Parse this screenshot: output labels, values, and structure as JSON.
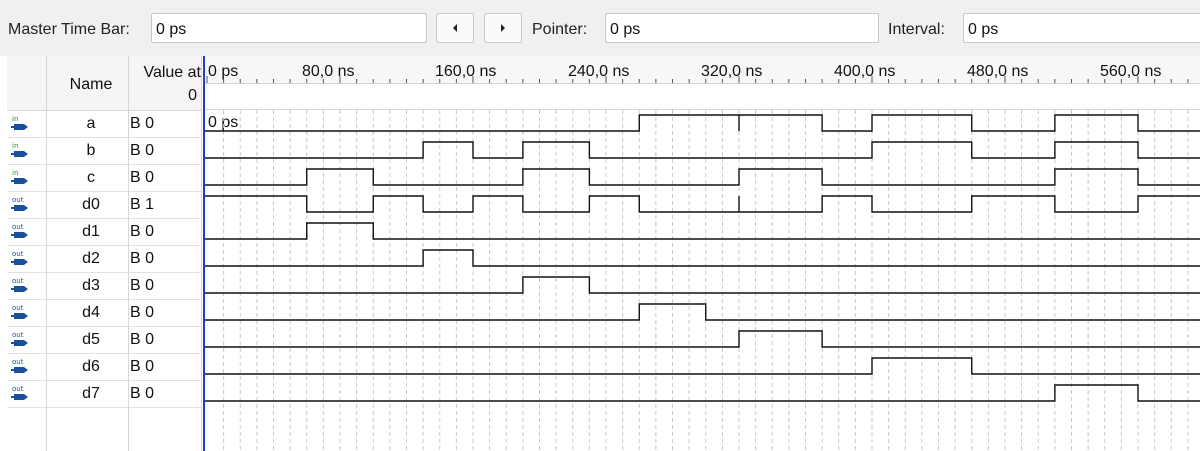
{
  "toolbar": {
    "master_label": "Master Time Bar:",
    "master_value": "0 ps",
    "prev_label": "◂",
    "next_label": "▸",
    "pointer_label": "Pointer:",
    "pointer_value": "0 ps",
    "interval_label": "Interval:",
    "interval_value": "0 ps"
  },
  "grid": {
    "name_header": "Name",
    "value_header": "Value at",
    "value_at": "0"
  },
  "timeline": {
    "ticks": [
      "0 ps",
      "80,0 ns",
      "160,0 ns",
      "240,0 ns",
      "320,0 ns",
      "400,0 ns",
      "480,0 ns",
      "560,0 ns"
    ],
    "pointer_value": "0 ps"
  },
  "signals": [
    {
      "name": "a",
      "value": "B 0",
      "dir": "in",
      "edges": [
        260,
        320,
        320,
        370,
        400,
        460,
        510,
        560
      ]
    },
    {
      "name": "b",
      "value": "B 0",
      "dir": "in",
      "edges": [
        130,
        160,
        190,
        230,
        400,
        460,
        510,
        560
      ]
    },
    {
      "name": "c",
      "value": "B 0",
      "dir": "in",
      "edges": [
        60,
        100,
        190,
        230,
        320,
        370,
        510,
        560
      ]
    },
    {
      "name": "d0",
      "value": "B 1",
      "dir": "out",
      "initial": 1,
      "edges": [
        60,
        100,
        130,
        160,
        190,
        230,
        260,
        320,
        320,
        370,
        400,
        460,
        510,
        560
      ]
    },
    {
      "name": "d1",
      "value": "B 0",
      "dir": "out",
      "edges": [
        60,
        100
      ]
    },
    {
      "name": "d2",
      "value": "B 0",
      "dir": "out",
      "edges": [
        130,
        160
      ]
    },
    {
      "name": "d3",
      "value": "B 0",
      "dir": "out",
      "edges": [
        190,
        230
      ]
    },
    {
      "name": "d4",
      "value": "B 0",
      "dir": "out",
      "edges": [
        260,
        300
      ]
    },
    {
      "name": "d5",
      "value": "B 0",
      "dir": "out",
      "edges": [
        320,
        370
      ]
    },
    {
      "name": "d6",
      "value": "B 0",
      "dir": "out",
      "edges": [
        400,
        460
      ]
    },
    {
      "name": "d7",
      "value": "B 0",
      "dir": "out",
      "edges": [
        510,
        560
      ]
    }
  ],
  "colors": {
    "wave": "#111111",
    "grid_dash": "#c8c8c8",
    "in_icon": "#2a8a2a",
    "out_icon": "#1a4f9a",
    "icon_body": "#1a4f9a",
    "cursor": "#1f3fbf"
  }
}
